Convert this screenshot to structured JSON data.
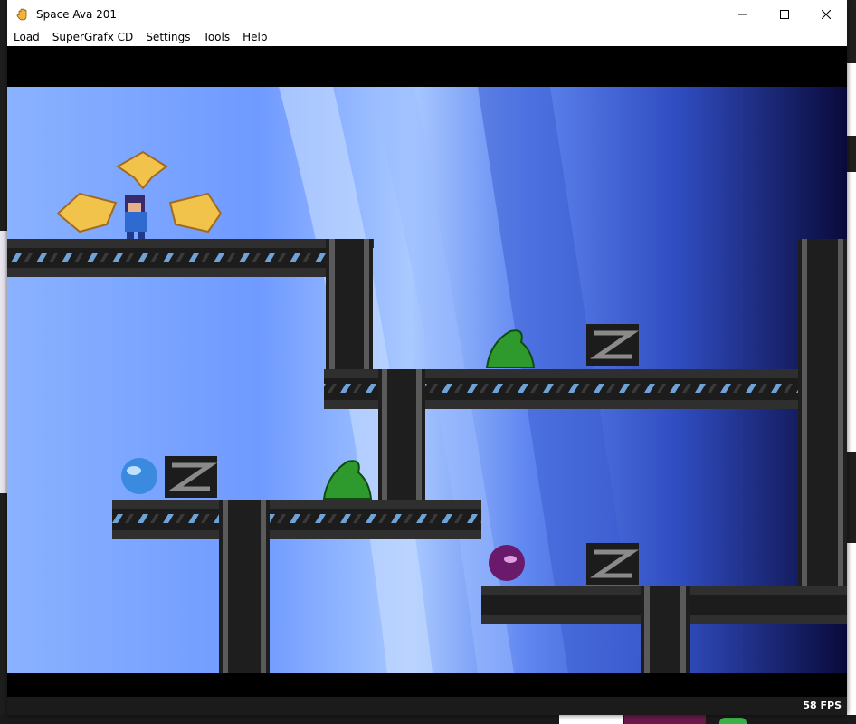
{
  "window": {
    "title": "Space Ava 201"
  },
  "menu": {
    "items": [
      {
        "label": "Load"
      },
      {
        "label": "SuperGrafx CD"
      },
      {
        "label": "Settings"
      },
      {
        "label": "Tools"
      },
      {
        "label": "Help"
      }
    ]
  },
  "status": {
    "fps": "58 FPS"
  },
  "icons": {
    "app": "hand-icon",
    "minimize": "minimize-icon",
    "maximize": "maximize-icon",
    "close": "close-icon"
  },
  "colors": {
    "titlebar": "#ffffff",
    "status_bg": "#1b1b1b",
    "sky_light": "#7aa8ff",
    "sky_dark": "#1a2a7a",
    "girder": "#2b2b2b",
    "enemy": "#2e9a2e"
  }
}
